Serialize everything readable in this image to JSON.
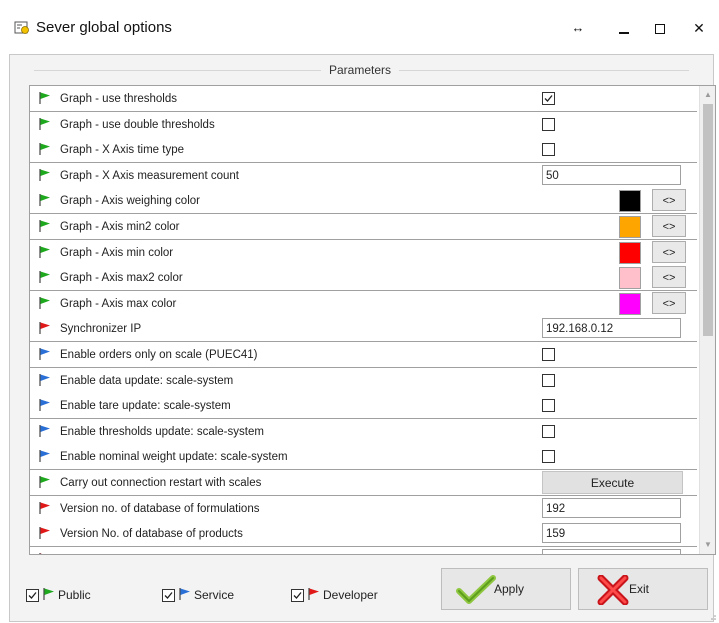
{
  "window": {
    "title": "Sever global options",
    "resize_glyph": "↔",
    "close_glyph": "✕"
  },
  "parameters_section": {
    "legend": "Parameters"
  },
  "flag_colors": {
    "green": "#1ea81e",
    "red": "#e01818",
    "blue": "#2a6fd6"
  },
  "rows": [
    {
      "label": "Graph - use thresholds",
      "flag": "green",
      "kind": "checkbox",
      "checked": true
    },
    {
      "label": "Graph - use double thresholds",
      "flag": "green",
      "kind": "checkbox",
      "checked": false
    },
    {
      "label": "Graph - X Axis time type",
      "flag": "green",
      "kind": "checkbox",
      "checked": false
    },
    {
      "label": "Graph - X Axis measurement count",
      "flag": "green",
      "kind": "text",
      "value": "50"
    },
    {
      "label": "Graph - Axis weighing color",
      "flag": "green",
      "kind": "color",
      "color": "#000000",
      "button": "<>"
    },
    {
      "label": "Graph - Axis min2 color",
      "flag": "green",
      "kind": "color",
      "color": "#ffa500",
      "button": "<>"
    },
    {
      "label": "Graph - Axis min color",
      "flag": "green",
      "kind": "color",
      "color": "#ff0000",
      "button": "<>"
    },
    {
      "label": "Graph - Axis max2 color",
      "flag": "green",
      "kind": "color",
      "color": "#ffc0cb",
      "button": "<>"
    },
    {
      "label": "Graph - Axis max color",
      "flag": "green",
      "kind": "color",
      "color": "#ff00ff",
      "button": "<>"
    },
    {
      "label": "Synchronizer IP",
      "flag": "red",
      "kind": "text",
      "value": "192.168.0.12"
    },
    {
      "label": "Enable orders only on scale (PUEC41)",
      "flag": "blue",
      "kind": "checkbox",
      "checked": false
    },
    {
      "label": "Enable data update: scale-system",
      "flag": "blue",
      "kind": "checkbox",
      "checked": false
    },
    {
      "label": "Enable tare update: scale-system",
      "flag": "blue",
      "kind": "checkbox",
      "checked": false
    },
    {
      "label": "Enable thresholds update: scale-system",
      "flag": "blue",
      "kind": "checkbox",
      "checked": false
    },
    {
      "label": "Enable nominal weight update: scale-system",
      "flag": "blue",
      "kind": "checkbox",
      "checked": false
    },
    {
      "label": "Carry out connection restart with scales",
      "flag": "green",
      "kind": "button",
      "button": "Execute"
    },
    {
      "label": "Version no. of database of formulations",
      "flag": "red",
      "kind": "text",
      "value": "192"
    },
    {
      "label": "Version No. of database of products",
      "flag": "red",
      "kind": "text",
      "value": "159"
    },
    {
      "label": "",
      "flag": "red",
      "kind": "text",
      "value": ""
    }
  ],
  "footer": {
    "filters": [
      {
        "label": "Public",
        "checked": true,
        "flag": "green"
      },
      {
        "label": "Service",
        "checked": true,
        "flag": "blue"
      },
      {
        "label": "Developer",
        "checked": true,
        "flag": "red"
      }
    ],
    "apply_label": "Apply",
    "exit_label": "Exit"
  },
  "icons": {
    "app": "scale-app-icon",
    "apply": "checkmark-icon",
    "exit": "red-x-icon"
  }
}
